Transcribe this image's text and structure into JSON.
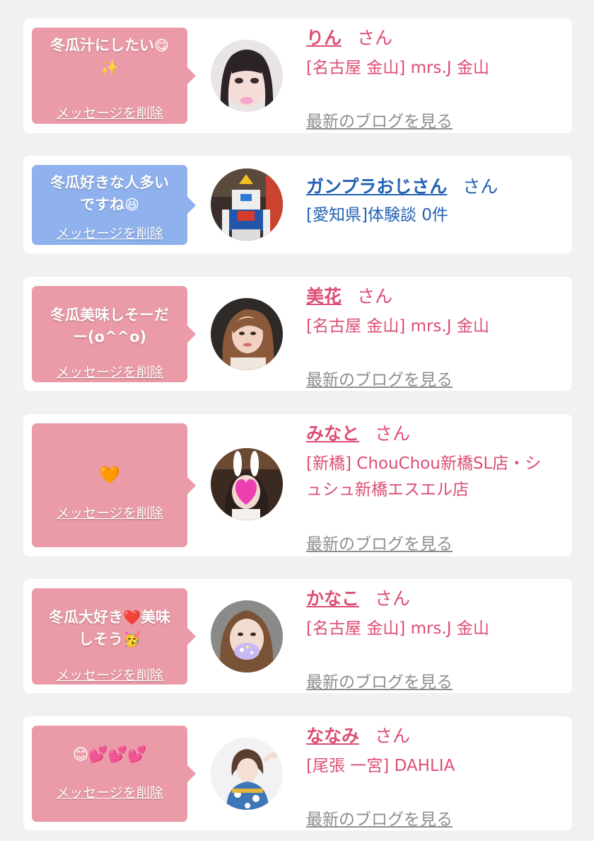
{
  "delete_label": "メッセージを削除",
  "blog_label": "最新のブログを見る",
  "san": "さん",
  "colors": {
    "pink_bubble": "#ea9ba7",
    "blue_bubble": "#8fb1ee",
    "pink_text": "#dd4e73",
    "blue_text": "#2261b4",
    "link_gray": "#8e8e8e"
  },
  "cards": [
    {
      "message_line1": "冬瓜汁にしたい",
      "message_line1_emoji": "😋",
      "message_line2_emoji": "✨",
      "name": "りん",
      "shop": "[名古屋 金山] mrs.J 金山",
      "avatar_icon": "girl-dark-hair-avatar-icon"
    },
    {
      "message_line1": "冬瓜好きな人多い",
      "message_line2": "ですね",
      "message_line2_emoji": "😆",
      "name": "ガンプラおじさん",
      "shop": "[愛知県]体験談 0件",
      "avatar_icon": "gundam-robot-avatar-icon"
    },
    {
      "message_line1": "冬瓜美味しそーだ",
      "message_line2": "ー(o^^o)",
      "name": "美花",
      "shop": "[名古屋 金山] mrs.J 金山",
      "avatar_icon": "woman-brown-hair-avatar-icon"
    },
    {
      "message_emoji": "🧡",
      "name": "みなと",
      "shop_line1": "[新橋] ChouChou新橋SL店・シ",
      "shop_line2": "ュシュ新橋エスエル店",
      "avatar_icon": "bunny-ears-heart-avatar-icon"
    },
    {
      "message_line1": "冬瓜大好き",
      "message_line1_emoji": "❤️",
      "message_line1_tail": "美味",
      "message_line2": "しそう",
      "message_line2_emoji": "🥳",
      "name": "かなこ",
      "shop": "[名古屋 金山] mrs.J 金山",
      "avatar_icon": "woman-sparkle-mask-avatar-icon"
    },
    {
      "message_emoji": "😊💕💕💕",
      "name": "ななみ",
      "shop": "[尾張 一宮] DAHLIA",
      "avatar_icon": "woman-yukata-avatar-icon"
    }
  ]
}
